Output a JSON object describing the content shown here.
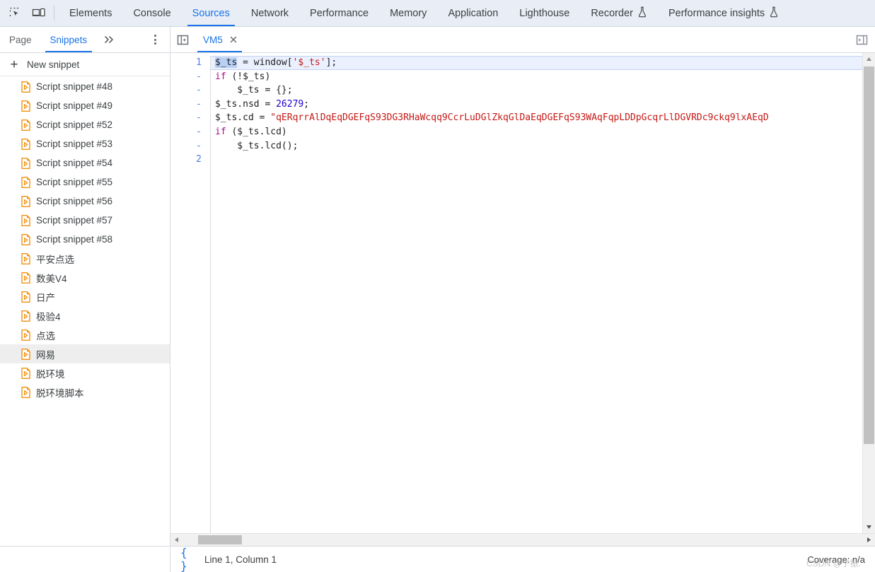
{
  "topbar": {
    "icons": [
      {
        "name": "inspect-element-icon",
        "label": "Inspect element"
      },
      {
        "name": "device-toolbar-icon",
        "label": "Toggle device toolbar"
      }
    ],
    "tabs": [
      {
        "label": "Elements",
        "active": false,
        "flask": false
      },
      {
        "label": "Console",
        "active": false,
        "flask": false
      },
      {
        "label": "Sources",
        "active": true,
        "flask": false
      },
      {
        "label": "Network",
        "active": false,
        "flask": false
      },
      {
        "label": "Performance",
        "active": false,
        "flask": false
      },
      {
        "label": "Memory",
        "active": false,
        "flask": false
      },
      {
        "label": "Application",
        "active": false,
        "flask": false
      },
      {
        "label": "Lighthouse",
        "active": false,
        "flask": false
      },
      {
        "label": "Recorder",
        "active": false,
        "flask": true
      },
      {
        "label": "Performance insights",
        "active": false,
        "flask": true
      }
    ]
  },
  "navigator": {
    "tabs": [
      {
        "label": "Page",
        "active": false
      },
      {
        "label": "Snippets",
        "active": true
      }
    ],
    "more_tabs_label": "»",
    "menu_label": "More options",
    "new_snippet_label": "New snippet",
    "snippets": [
      {
        "label": "Script snippet #48",
        "selected": false
      },
      {
        "label": "Script snippet #49",
        "selected": false
      },
      {
        "label": "Script snippet #52",
        "selected": false
      },
      {
        "label": "Script snippet #53",
        "selected": false
      },
      {
        "label": "Script snippet #54",
        "selected": false
      },
      {
        "label": "Script snippet #55",
        "selected": false
      },
      {
        "label": "Script snippet #56",
        "selected": false
      },
      {
        "label": "Script snippet #57",
        "selected": false
      },
      {
        "label": "Script snippet #58",
        "selected": false
      },
      {
        "label": "平安点选",
        "selected": false
      },
      {
        "label": "数美V4",
        "selected": false
      },
      {
        "label": "日产",
        "selected": false
      },
      {
        "label": "极验4",
        "selected": false
      },
      {
        "label": "点选",
        "selected": false
      },
      {
        "label": "网易",
        "selected": true
      },
      {
        "label": "脱环境",
        "selected": false
      },
      {
        "label": "脱环境脚本",
        "selected": false
      }
    ]
  },
  "editor": {
    "show_navigator_label": "Show navigator",
    "show_debugger_label": "Show debugger",
    "file_tab": {
      "label": "VM5",
      "close_label": "×"
    },
    "gutter": [
      "1",
      "-",
      "-",
      "-",
      "-",
      "-",
      "-",
      "2"
    ],
    "lines": [
      {
        "active": true,
        "tokens": [
          {
            "t": "$_ts",
            "c": "sel"
          },
          {
            "t": " = window[",
            "c": ""
          },
          {
            "t": "'$_ts'",
            "c": "tok-str"
          },
          {
            "t": "];",
            "c": ""
          }
        ]
      },
      {
        "active": false,
        "tokens": [
          {
            "t": "if",
            "c": "tok-kw"
          },
          {
            "t": " (!$_ts)",
            "c": ""
          }
        ]
      },
      {
        "active": false,
        "tokens": [
          {
            "t": "    $_ts = {};",
            "c": ""
          }
        ]
      },
      {
        "active": false,
        "tokens": [
          {
            "t": "$_ts.nsd = ",
            "c": ""
          },
          {
            "t": "26279",
            "c": "tok-num"
          },
          {
            "t": ";",
            "c": ""
          }
        ]
      },
      {
        "active": false,
        "tokens": [
          {
            "t": "$_ts.cd = ",
            "c": ""
          },
          {
            "t": "\"qERqrrAlDqEqDGEFqS93DG3RHaWcqq9CcrLuDGlZkqGlDaEqDGEFqS93WAqFqpLDDpGcqrLlDGVRDc9ckq9lxAEqD",
            "c": "tok-str"
          }
        ]
      },
      {
        "active": false,
        "tokens": [
          {
            "t": "if",
            "c": "tok-kw"
          },
          {
            "t": " ($_ts.lcd)",
            "c": ""
          }
        ]
      },
      {
        "active": false,
        "tokens": [
          {
            "t": "    $_ts.lcd();",
            "c": ""
          }
        ]
      }
    ]
  },
  "statusbar": {
    "pretty_print_icon": "{ }",
    "cursor_position": "Line 1, Column 1",
    "coverage": "Coverage: n/a",
    "watermark": "CSDN @宁振."
  },
  "colors": {
    "accent": "#1a73e8",
    "header_bg": "#e9eef6",
    "snippet_icon": "#f29111",
    "string": "#c41a16",
    "keyword": "#aa0d91",
    "number": "#1c00cf",
    "selection": "#b9d0f5",
    "active_line": "#eaf0fd"
  }
}
